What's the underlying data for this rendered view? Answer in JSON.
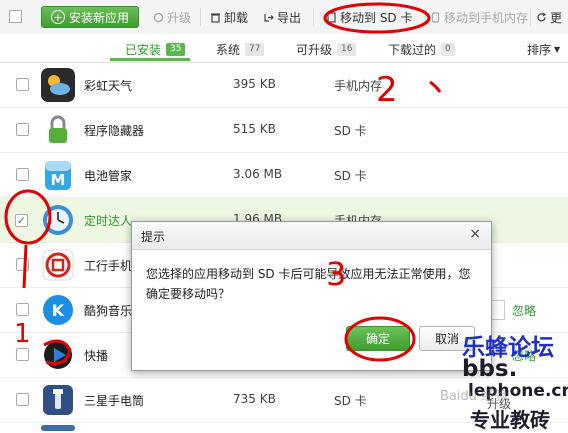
{
  "toolbar": {
    "install": "安装新应用",
    "upgrade": "升级",
    "uninstall": "卸载",
    "export": "导出",
    "move_to_sd": "移动到 SD 卡",
    "move_to_phone": "移动到手机内存",
    "more": "更"
  },
  "tabs": [
    {
      "label": "已安装",
      "count": "35"
    },
    {
      "label": "系统",
      "count": "77"
    },
    {
      "label": "可升级",
      "count": "16"
    },
    {
      "label": "下载过的",
      "count": "0"
    },
    {
      "label": "排序"
    }
  ],
  "apps": [
    {
      "name": "彩虹天气",
      "size": "395 KB",
      "location": "手机内存"
    },
    {
      "name": "程序隐藏器",
      "size": "515 KB",
      "location": "SD 卡"
    },
    {
      "name": "电池管家",
      "size": "3.06 MB",
      "location": "SD 卡"
    },
    {
      "name": "定时达人",
      "size": "1.96 MB",
      "location": "手机内存",
      "checked": true
    },
    {
      "name": "工行手机",
      "size": "",
      "location": ""
    },
    {
      "name": "酷狗音乐",
      "size": "",
      "location": "",
      "action": "忽略"
    },
    {
      "name": "快播",
      "size": "",
      "location": "",
      "action": "忽略"
    },
    {
      "name": "三星手电筒",
      "size": "735 KB",
      "location": "SD 卡"
    },
    {
      "name": "",
      "size": "",
      "location": ""
    }
  ],
  "dialog": {
    "title": "提示",
    "close": "×",
    "message": "您选择的应用移动到 SD 卡后可能导致应用无法正常使用，您确定要移动吗？",
    "ok": "确定",
    "cancel": "取消"
  },
  "annotations": [
    "1",
    "2",
    "3"
  ],
  "watermark": {
    "site": "乐蜂论坛",
    "url_line1": "bbs.",
    "url_line2": "lephone.cn",
    "tagline": "专业教砖",
    "overlay": "Baidu 经验",
    "partial_action": "升级"
  },
  "colors": {
    "accent": "#5cb84c",
    "annotation": "#e00000",
    "watermark": "#1f2fc8"
  }
}
